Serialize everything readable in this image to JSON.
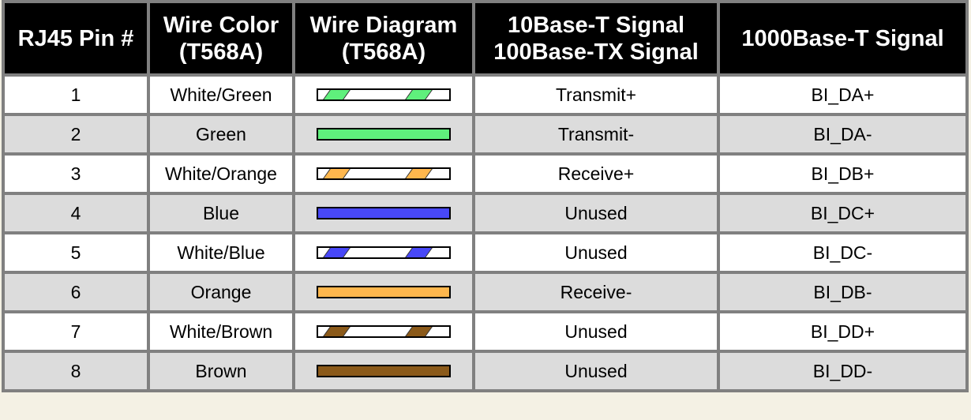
{
  "table": {
    "headers": [
      {
        "line1": "RJ45 Pin #",
        "line2": ""
      },
      {
        "line1": "Wire Color",
        "line2": "(T568A)"
      },
      {
        "line1": "Wire Diagram",
        "line2": "(T568A)"
      },
      {
        "line1": "10Base-T Signal",
        "line2": "100Base-TX Signal"
      },
      {
        "line1": "1000Base-T Signal",
        "line2": ""
      }
    ],
    "rows": [
      {
        "pin": "1",
        "color": "White/Green",
        "wire_color": "#5ff07c",
        "striped": true,
        "signal_100": "Transmit+",
        "signal_1000": "BI_DA+"
      },
      {
        "pin": "2",
        "color": "Green",
        "wire_color": "#5ff07c",
        "striped": false,
        "signal_100": "Transmit-",
        "signal_1000": "BI_DA-"
      },
      {
        "pin": "3",
        "color": "White/Orange",
        "wire_color": "#ffb74d",
        "striped": true,
        "signal_100": "Receive+",
        "signal_1000": "BI_DB+"
      },
      {
        "pin": "4",
        "color": "Blue",
        "wire_color": "#4848f8",
        "striped": false,
        "signal_100": "Unused",
        "signal_1000": "BI_DC+"
      },
      {
        "pin": "5",
        "color": "White/Blue",
        "wire_color": "#4848f8",
        "striped": true,
        "signal_100": "Unused",
        "signal_1000": "BI_DC-"
      },
      {
        "pin": "6",
        "color": "Orange",
        "wire_color": "#ffb74d",
        "striped": false,
        "signal_100": "Receive-",
        "signal_1000": "BI_DB-"
      },
      {
        "pin": "7",
        "color": "White/Brown",
        "wire_color": "#8b5a1a",
        "striped": true,
        "signal_100": "Unused",
        "signal_1000": "BI_DD+"
      },
      {
        "pin": "8",
        "color": "Brown",
        "wire_color": "#8b5a1a",
        "striped": false,
        "signal_100": "Unused",
        "signal_1000": "BI_DD-"
      }
    ]
  }
}
